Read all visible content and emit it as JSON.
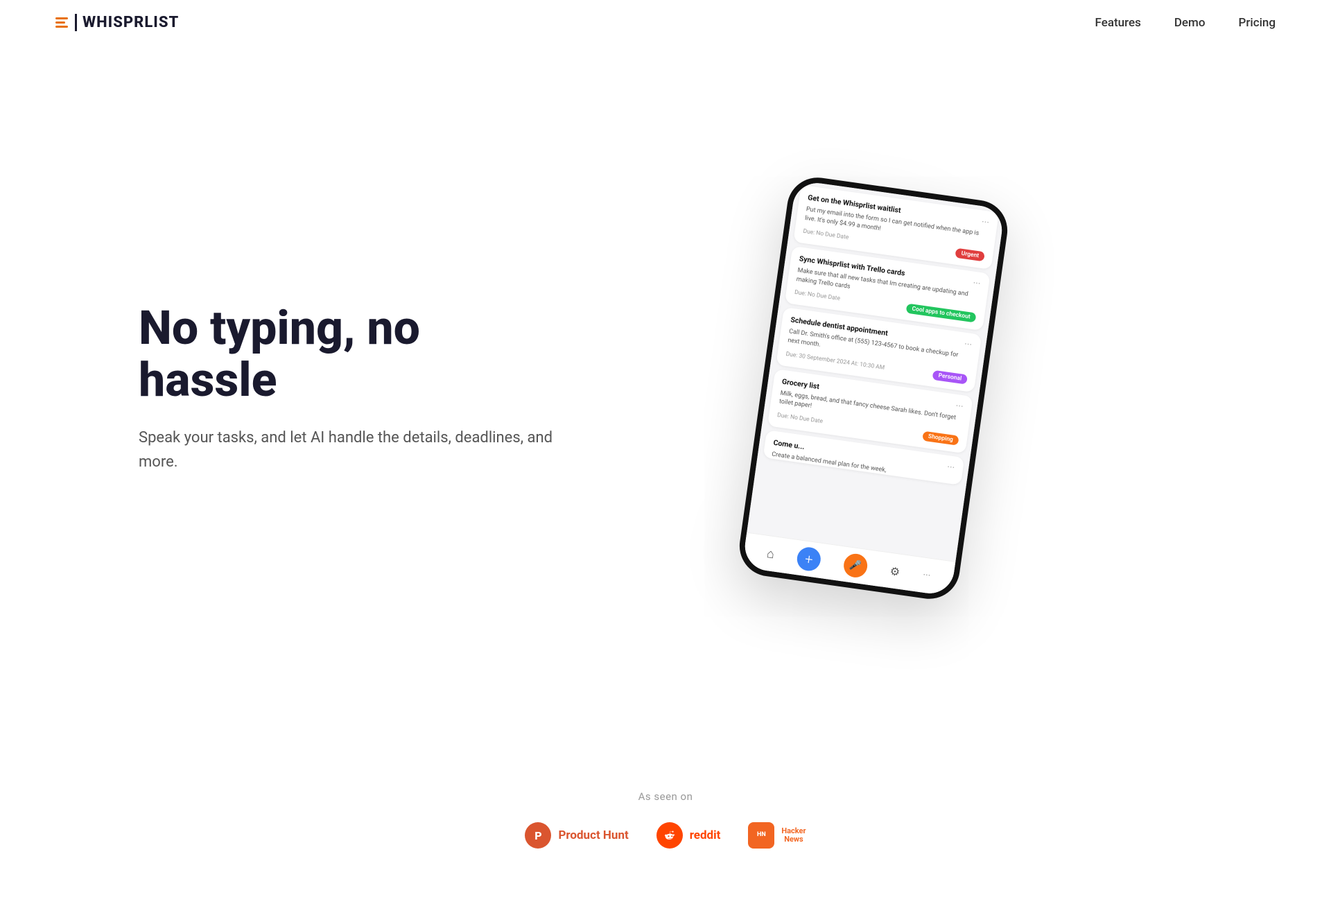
{
  "nav": {
    "logo_text": "WHISPRLIST",
    "links": [
      {
        "label": "Features",
        "href": "#"
      },
      {
        "label": "Demo",
        "href": "#"
      },
      {
        "label": "Pricing",
        "href": "#"
      }
    ]
  },
  "hero": {
    "title": "No typing, no hassle",
    "subtitle": "Speak your tasks, and let AI handle the details, deadlines, and more."
  },
  "phone": {
    "tasks": [
      {
        "title": "Get on the Whisprlist waitlist",
        "body": "Put my email into the form so I can get notified when the app is live. It's only $4.99 a month!",
        "due": "Due: No Due Date",
        "tag": "Urgent",
        "tag_class": "tag-urgent"
      },
      {
        "title": "Sync Whisprlist with Trello cards",
        "body": "Make sure that all new tasks that Im creating are updating and making Trello cards",
        "due": "Due: No Due Date",
        "tag": "Cool apps to checkout",
        "tag_class": "tag-cool"
      },
      {
        "title": "Schedule dentist appointment",
        "body": "Call Dr. Smith's office at (555) 123-4567 to book a checkup for next month.",
        "due": "Due: 30 September 2024 At: 10:30 AM",
        "tag": "Personal",
        "tag_class": "tag-personal"
      },
      {
        "title": "Grocery list",
        "body": "Milk, eggs, bread, and that fancy cheese Sarah likes. Don't forget toilet paper!",
        "due": "Due: No Due Date",
        "tag": "Shopping",
        "tag_class": "tag-shopping"
      },
      {
        "title": "Come u...",
        "body": "Create a balanced meal plan for the week,",
        "due": "",
        "tag": "",
        "tag_class": ""
      }
    ]
  },
  "social_proof": {
    "label": "As seen on",
    "logos": [
      {
        "name": "Product Hunt",
        "icon_label": "P",
        "color_class": "ph-icon",
        "text_class": "ph-text"
      },
      {
        "name": "reddit",
        "icon_label": "👾",
        "color_class": "reddit-icon",
        "text_class": "reddit-text"
      },
      {
        "name": "Hacker News",
        "icon_label": "HN",
        "color_class": "hn-icon",
        "text_class": "hn-text"
      }
    ]
  }
}
